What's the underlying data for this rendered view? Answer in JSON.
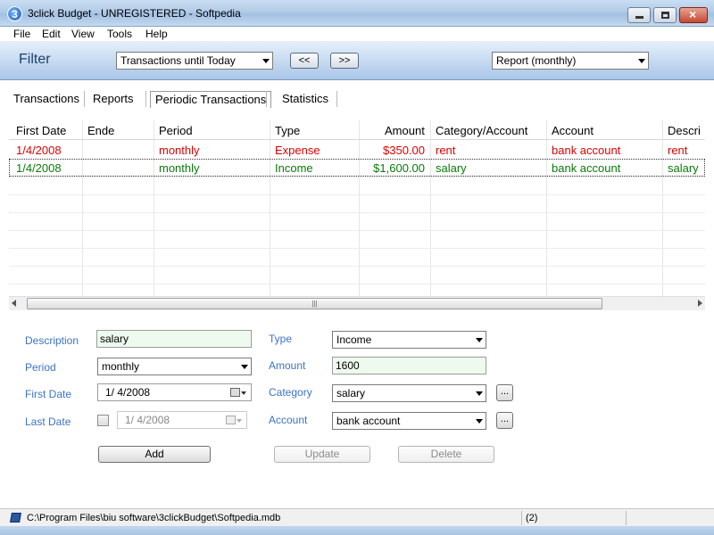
{
  "window": {
    "title": "3click Budget - UNREGISTERED  - Softpedia",
    "app_icon": "3"
  },
  "menu": [
    "File",
    "Edit",
    "View",
    "Tools",
    "Help"
  ],
  "filter": {
    "label": "Filter",
    "range_select": "Transactions until Today",
    "prev_label": "<<",
    "next_label": ">>",
    "report_select": "Report (monthly)"
  },
  "tabs": [
    {
      "label": "Transactions",
      "active": false
    },
    {
      "label": "Reports",
      "active": false
    },
    {
      "label": "Periodic Transactions",
      "active": true
    },
    {
      "label": "Statistics",
      "active": false
    }
  ],
  "grid": {
    "columns": [
      "First Date",
      "Ende",
      "Period",
      "Type",
      "Amount",
      "Category/Account",
      "Account",
      "Descri"
    ],
    "rows": [
      {
        "first_date": "1/4/2008",
        "ende": "",
        "period": "monthly",
        "type": "Expense",
        "amount": "$350.00",
        "category": "rent",
        "account": "bank account",
        "description": "rent",
        "color": "#e00000"
      },
      {
        "first_date": "1/4/2008",
        "ende": "",
        "period": "monthly",
        "type": "Income",
        "amount": "$1,600.00",
        "category": "salary",
        "account": "bank account",
        "description": "salary",
        "color": "#0a7a0a"
      }
    ]
  },
  "form": {
    "description_label": "Description",
    "description_value": "salary",
    "period_label": "Period",
    "period_value": "monthly",
    "first_date_label": "First Date",
    "first_date_value": "1/  4/2008",
    "last_date_label": "Last Date",
    "last_date_value": "1/  4/2008",
    "type_label": "Type",
    "type_value": "Income",
    "amount_label": "Amount",
    "amount_value": "1600",
    "category_label": "Category",
    "category_value": "salary",
    "account_label": "Account",
    "account_value": "bank account",
    "dots": "...",
    "add_label": "Add",
    "update_label": "Update",
    "delete_label": "Delete"
  },
  "status": {
    "path": "C:\\Program Files\\biu software\\3clickBudget\\Softpedia.mdb",
    "count": "(2)"
  },
  "colors": {
    "label_blue": "#3c73c5",
    "expense_red": "#e00000",
    "income_green": "#0a7a0a"
  }
}
